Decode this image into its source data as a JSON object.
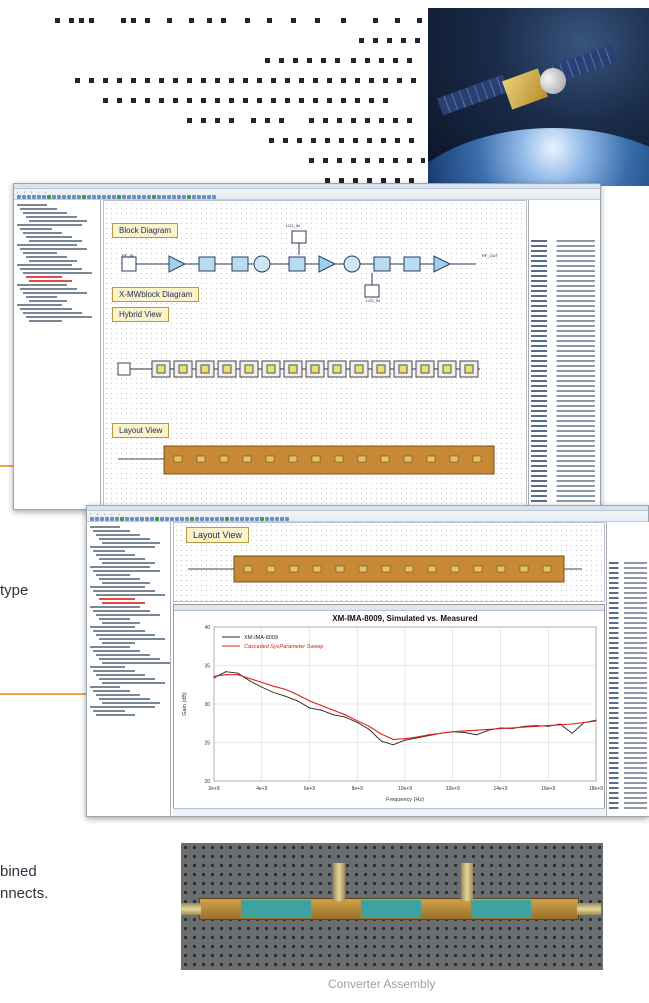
{
  "window1": {
    "diagram_labels": {
      "block": "Block Diagram",
      "xmw": "X-MWblock Diagram",
      "hybrid": "Hybrid View",
      "layout": "Layout View"
    },
    "ports": {
      "rf_in": "RF_IN",
      "rf_out": "RF_OUT",
      "lo1": "LO1_IN",
      "lo2": "LO2_IN"
    }
  },
  "window2": {
    "layout_label": "Layout View",
    "plot_panel_title": "XM-IMA-8009, Simulated vs. Measured"
  },
  "chart_data": {
    "type": "line",
    "title": "XM-IMA-8009, Simulated vs. Measured",
    "xlabel": "Frequency (Hz)",
    "ylabel": "Gain (dB)",
    "xlim": [
      2000000000.0,
      18000000000.0
    ],
    "ylim": [
      20,
      40
    ],
    "x_ticks": [
      "2e+9",
      "4e+9",
      "6e+9",
      "8e+9",
      "10e+9",
      "12e+9",
      "14e+9",
      "16e+9",
      "18e+9"
    ],
    "y_ticks": [
      "20",
      "25",
      "30",
      "35",
      "40"
    ],
    "legend_position": "top-left",
    "grid": true,
    "series": [
      {
        "name": "XM-IMA-8009",
        "color": "#222222",
        "x": [
          2000000000.0,
          2500000000.0,
          3000000000.0,
          3500000000.0,
          4000000000.0,
          4500000000.0,
          5000000000.0,
          5500000000.0,
          6000000000.0,
          6500000000.0,
          7000000000.0,
          7500000000.0,
          8000000000.0,
          8500000000.0,
          9000000000.0,
          9500000000.0,
          10000000000.0,
          10500000000.0,
          11000000000.0,
          11500000000.0,
          12000000000.0,
          12500000000.0,
          13000000000.0,
          13500000000.0,
          14000000000.0,
          14500000000.0,
          15000000000.0,
          15500000000.0,
          16000000000.0,
          16500000000.0,
          17000000000.0,
          17500000000.0,
          18000000000.0
        ],
        "y": [
          33.4,
          34.2,
          34.0,
          33.0,
          32.2,
          31.5,
          31.0,
          30.4,
          29.5,
          29.2,
          28.6,
          28.3,
          27.6,
          26.7,
          25.2,
          24.7,
          25.3,
          25.6,
          25.9,
          26.2,
          26.4,
          26.3,
          26.0,
          26.6,
          26.9,
          26.8,
          27.1,
          27.2,
          27.1,
          27.4,
          26.2,
          27.6,
          27.9
        ]
      },
      {
        "name": "Cascaded SysParameter Sweep",
        "color": "#e0201c",
        "x": [
          2000000000.0,
          2500000000.0,
          3000000000.0,
          3500000000.0,
          4000000000.0,
          4500000000.0,
          5000000000.0,
          5500000000.0,
          6000000000.0,
          6500000000.0,
          7000000000.0,
          7500000000.0,
          8000000000.0,
          8500000000.0,
          9000000000.0,
          9500000000.0,
          10000000000.0,
          10500000000.0,
          11000000000.0,
          11500000000.0,
          12000000000.0,
          12500000000.0,
          13000000000.0,
          13500000000.0,
          14000000000.0,
          14500000000.0,
          15000000000.0,
          15500000000.0,
          16000000000.0,
          16500000000.0,
          17000000000.0,
          17500000000.0,
          18000000000.0
        ],
        "y": [
          33.6,
          33.8,
          33.8,
          33.3,
          32.8,
          32.3,
          31.9,
          31.2,
          30.4,
          29.8,
          29.2,
          28.6,
          27.8,
          27.1,
          26.1,
          25.4,
          25.5,
          25.7,
          26.0,
          26.2,
          26.4,
          26.5,
          26.6,
          26.7,
          26.8,
          26.9,
          27.0,
          27.1,
          27.2,
          27.3,
          27.4,
          27.6,
          27.8
        ]
      }
    ]
  },
  "side_text": {
    "line1": "type",
    "line2": "bined",
    "line3": "nnects."
  },
  "caption": "Converter Assembly"
}
